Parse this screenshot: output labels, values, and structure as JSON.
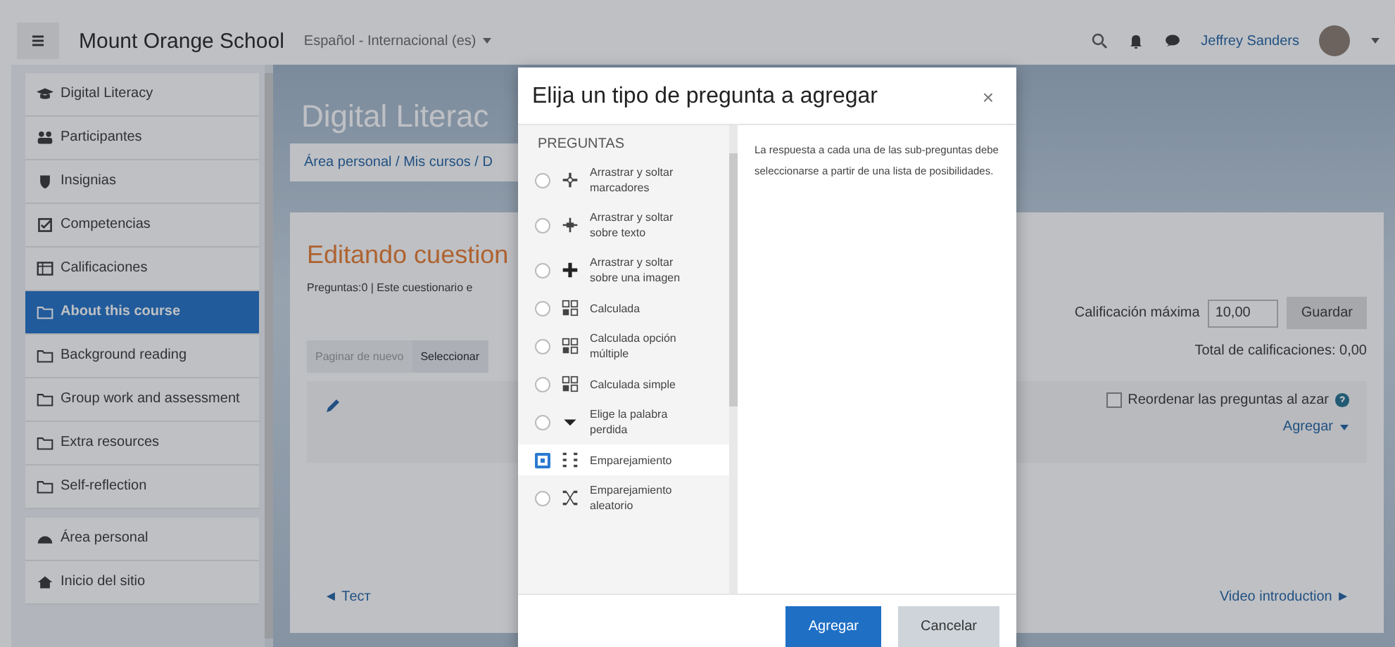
{
  "navbar": {
    "brand": "Mount Orange School",
    "language": "Español - Internacional (es)",
    "user_name": "Jeffrey Sanders"
  },
  "sidebar": {
    "groups": [
      {
        "items": [
          {
            "label": "Digital Literacy",
            "kind": "cap",
            "selected": false
          },
          {
            "label": "Participantes",
            "kind": "users",
            "selected": false
          },
          {
            "label": "Insignias",
            "kind": "shield",
            "selected": false
          },
          {
            "label": "Competencias",
            "kind": "check",
            "selected": false
          },
          {
            "label": "Calificaciones",
            "kind": "table",
            "selected": false
          },
          {
            "label": "About this course",
            "kind": "folder",
            "selected": true
          },
          {
            "label": "Background reading",
            "kind": "folder",
            "selected": false
          },
          {
            "label": "Group work and assessment",
            "kind": "folder",
            "selected": false
          },
          {
            "label": "Extra resources",
            "kind": "folder",
            "selected": false
          },
          {
            "label": "Self-reflection",
            "kind": "folder",
            "selected": false
          }
        ]
      },
      {
        "items": [
          {
            "label": "Área personal",
            "kind": "dashboard",
            "selected": false
          },
          {
            "label": "Inicio del sitio",
            "kind": "home",
            "selected": false
          }
        ]
      }
    ]
  },
  "header": {
    "title": "Digital Literac",
    "breadcrumb": "Área personal / Mis cursos / D"
  },
  "editor": {
    "heading": "Editando cuestion",
    "info": "Preguntas:0 | Este cuestionario e",
    "toolbar": [
      {
        "label": "Paginar de nuevo",
        "disabled": true
      },
      {
        "label": "Seleccionar",
        "disabled": false
      }
    ],
    "max_grade_label": "Calificación máxima",
    "max_grade_value": "10,00",
    "save_button": "Guardar",
    "total": "Total de calificaciones: 0,00",
    "shuffle": {
      "label": "Reordenar las preguntas al azar",
      "checked": false
    },
    "add_menu": "Agregar",
    "prev_link": "◄ Тест",
    "next_link": "Video introduction ►"
  },
  "dialog": {
    "title": "Elija un tipo de pregunta a agregar",
    "close": "×",
    "section": "PREGUNTAS",
    "question_types": [
      {
        "label": "Arrastrar y soltar marcadores",
        "kind": "markers",
        "selected": false
      },
      {
        "label": "Arrastrar y soltar sobre texto",
        "kind": "dragtext",
        "selected": false
      },
      {
        "label": "Arrastrar y soltar sobre una imagen",
        "kind": "cross",
        "selected": false
      },
      {
        "label": "Calculada",
        "kind": "calc",
        "selected": false
      },
      {
        "label": "Calculada opción múltiple",
        "kind": "calc",
        "selected": false
      },
      {
        "label": "Calculada simple",
        "kind": "calc",
        "selected": false
      },
      {
        "label": "Elige la palabra perdida",
        "kind": "caret",
        "selected": false
      },
      {
        "label": "Emparejamiento",
        "kind": "match",
        "selected": true
      },
      {
        "label": "Emparejamiento aleatorio",
        "kind": "random",
        "selected": false
      }
    ],
    "description": "La respuesta a cada una de las sub-preguntas debe seleccionarse a partir de una lista de posibilidades.",
    "buttons": [
      {
        "label": "Agregar",
        "kind": "primary"
      },
      {
        "label": "Cancelar",
        "kind": "secondary"
      }
    ]
  }
}
